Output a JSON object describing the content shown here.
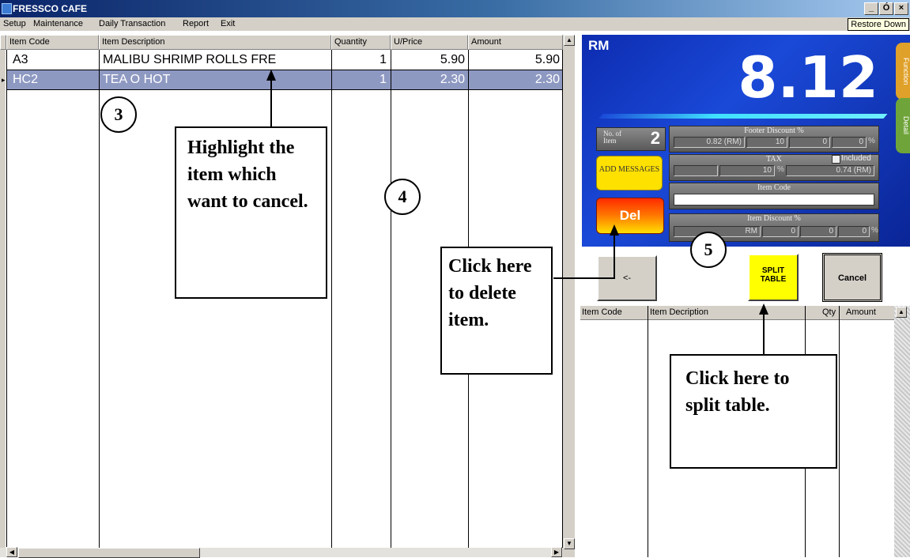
{
  "window": {
    "title": "FRESSCO CAFE",
    "min": "_",
    "max": "Ó",
    "close": "×",
    "restore_tooltip": "Restore Down"
  },
  "menu": [
    "Setup",
    "Maintenance",
    "Daily Transaction",
    "Report",
    "Exit"
  ],
  "grid": {
    "columns": [
      "Item Code",
      "Item Description",
      "Quantity",
      "U/Price",
      "Amount"
    ],
    "rows": [
      {
        "code": "A3",
        "desc": "MALIBU SHRIMP ROLLS FRE",
        "qty": "1",
        "price": "5.90",
        "amount": "5.90"
      },
      {
        "code": "HC2",
        "desc": "TEA O HOT",
        "qty": "1",
        "price": "2.30",
        "amount": "2.30"
      }
    ]
  },
  "panel": {
    "currency": "RM",
    "total": "8.12",
    "tab_function": "Function",
    "tab_detail": "Detail",
    "no_of_item_label": "No. of Item",
    "no_of_item_value": "2",
    "footer_discount_label": "Footer Discount %",
    "footer_discount_rm": "0.82 (RM)",
    "footer_discount_v1": "10",
    "footer_discount_v2": "0",
    "footer_discount_v3": "0",
    "pct": "%",
    "tax_label": "TAX",
    "tax_included": "Included",
    "tax_rate": "10",
    "tax_rm": "0.74 (RM)",
    "item_code_label": "Item Code",
    "item_discount_label": "Item Discount %",
    "item_discount_rm": "RM",
    "item_discount_v1": "0",
    "item_discount_v2": "0",
    "item_discount_v3": "0",
    "add_messages": "ADD MESSAGES",
    "del": "Del"
  },
  "buttons": {
    "back": "<-",
    "split": "SPLIT TABLE",
    "cancel": "Cancel"
  },
  "split_grid": {
    "columns": [
      "Item Code",
      "Item Decription",
      "Qty",
      "Amount"
    ]
  },
  "annotations": {
    "n3": "3",
    "n4": "4",
    "n5": "5",
    "highlight": "Highlight the item which want to cancel.",
    "delete": "Click here to delete item.",
    "split": "Click here to split table."
  }
}
